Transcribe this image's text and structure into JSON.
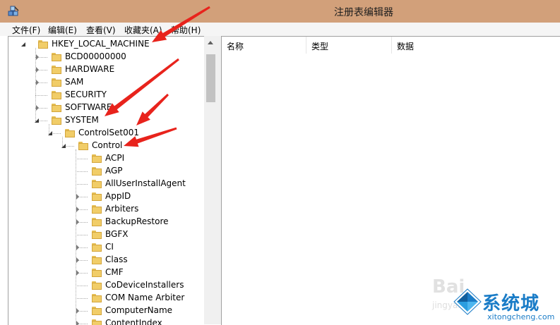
{
  "window": {
    "title": "注册表编辑器",
    "icon": "regedit-icon"
  },
  "menu": [
    "文件(F)",
    "编辑(E)",
    "查看(V)",
    "收藏夹(A)",
    "帮助(H)"
  ],
  "tree": [
    {
      "label": "HKEY_LOCAL_MACHINE",
      "expander": "expanded"
    },
    {
      "label": "BCD00000000",
      "expander": "collapsed"
    },
    {
      "label": "HARDWARE",
      "expander": "collapsed"
    },
    {
      "label": "SAM",
      "expander": "collapsed"
    },
    {
      "label": "SECURITY",
      "expander": "none"
    },
    {
      "label": "SOFTWARE",
      "expander": "collapsed"
    },
    {
      "label": "SYSTEM",
      "expander": "expanded"
    },
    {
      "label": "ControlSet001",
      "expander": "expanded"
    },
    {
      "label": "Control",
      "expander": "expanded"
    },
    {
      "label": "ACPI",
      "expander": "none"
    },
    {
      "label": "AGP",
      "expander": "none"
    },
    {
      "label": "AllUserInstallAgent",
      "expander": "none"
    },
    {
      "label": "AppID",
      "expander": "collapsed"
    },
    {
      "label": "Arbiters",
      "expander": "collapsed"
    },
    {
      "label": "BackupRestore",
      "expander": "collapsed"
    },
    {
      "label": "BGFX",
      "expander": "none"
    },
    {
      "label": "CI",
      "expander": "collapsed"
    },
    {
      "label": "Class",
      "expander": "collapsed"
    },
    {
      "label": "CMF",
      "expander": "collapsed"
    },
    {
      "label": "CoDeviceInstallers",
      "expander": "none"
    },
    {
      "label": "COM Name Arbiter",
      "expander": "none"
    },
    {
      "label": "ComputerName",
      "expander": "collapsed"
    },
    {
      "label": "ContentIndex",
      "expander": "collapsed"
    }
  ],
  "columns": [
    "名称",
    "类型",
    "数据"
  ],
  "annotation_color": "#e8231c",
  "watermark": {
    "baidu": "Bai",
    "jingyan": "jingyan",
    "brand": "系统城",
    "url": "xitongcheng.com"
  }
}
